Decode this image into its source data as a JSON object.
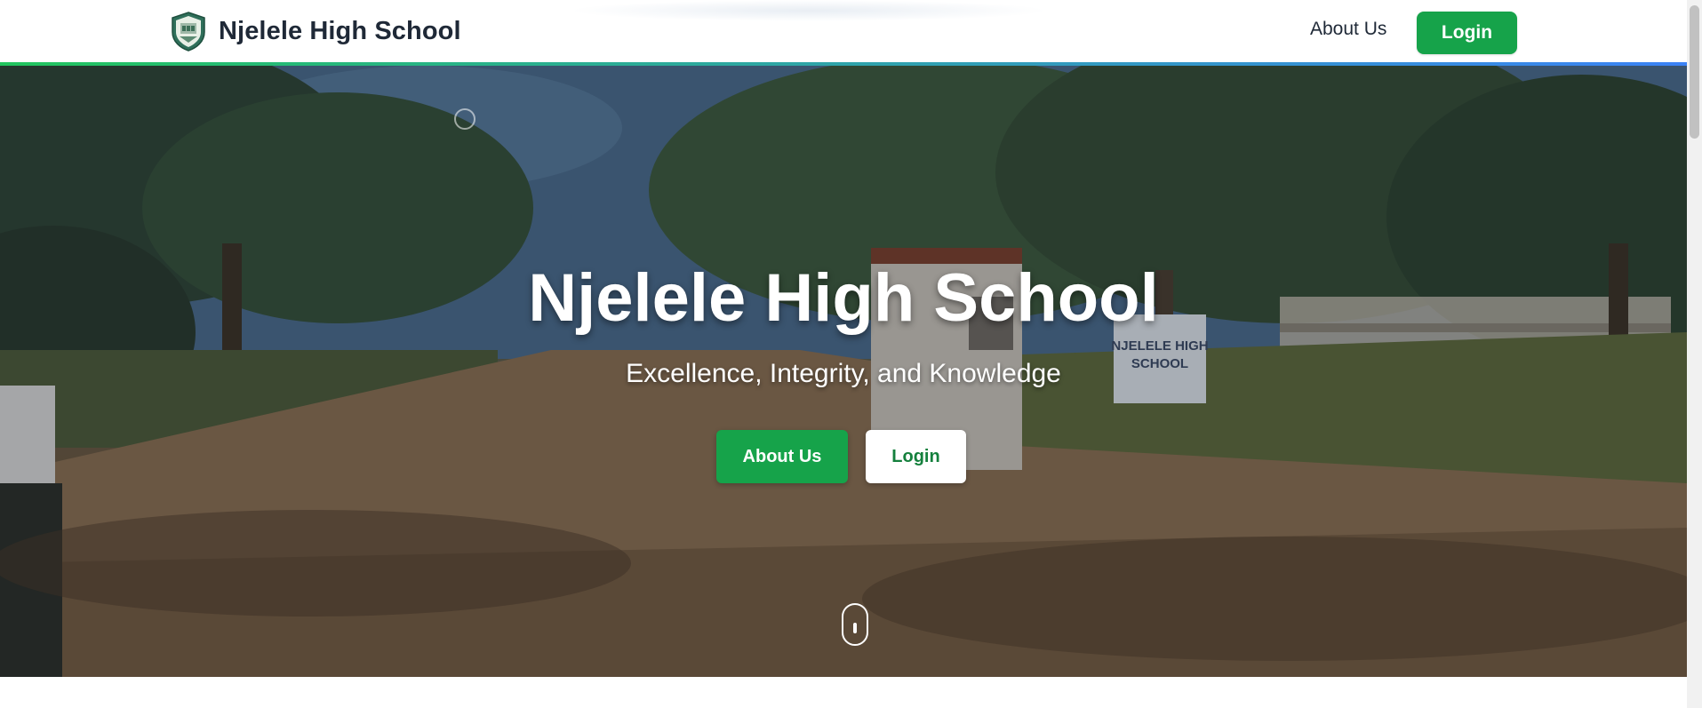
{
  "header": {
    "brand_name": "Njelele High School",
    "logo_icon": "school-crest-icon",
    "nav_links": [
      "About Us"
    ],
    "login_label": "Login"
  },
  "hero": {
    "title": "Njelele High School",
    "subtitle": "Excellence, Integrity, and Knowledge",
    "primary_button": "About Us",
    "secondary_button": "Login",
    "scroll_icon": "mouse-scroll-icon",
    "sign_text": "NJELELE HIGH SCHOOL"
  },
  "colors": {
    "primary_green": "#16a34a",
    "text_dark": "#1f2937",
    "accent_gradient_start": "#22c55e",
    "accent_gradient_end": "#3b82f6"
  }
}
